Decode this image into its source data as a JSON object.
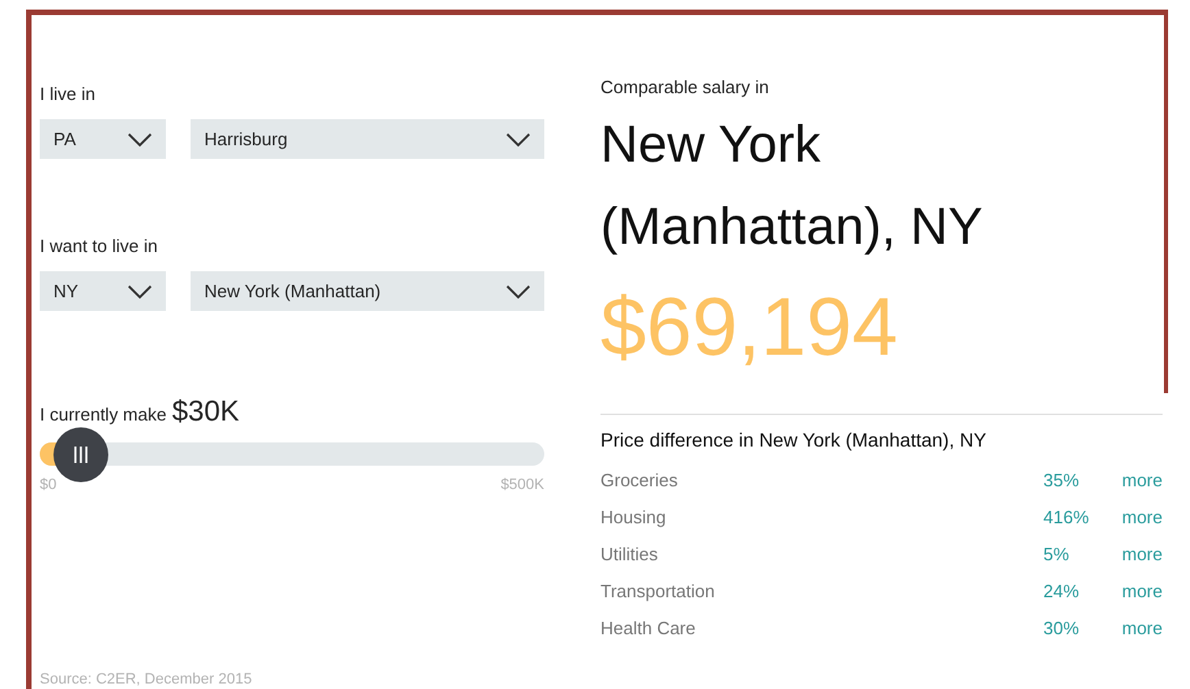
{
  "home": {
    "label": "I live in",
    "state": "PA",
    "city": "Harrisburg"
  },
  "destination": {
    "label": "I want to live in",
    "state": "NY",
    "city": "New York (Manhattan)"
  },
  "income": {
    "label": "I currently make",
    "amount": "$30K",
    "level": 0.06,
    "min_label": "$0",
    "max_label": "$500K"
  },
  "source": "Source: C2ER, December 2015",
  "result": {
    "label": "Comparable salary in",
    "city": "New York (Manhattan), NY",
    "salary": "$69,194"
  },
  "price_difference": {
    "title": "Price difference in New York (Manhattan), NY",
    "rows": [
      {
        "category": "Groceries",
        "percent": "35%",
        "link": "more"
      },
      {
        "category": "Housing",
        "percent": "416%",
        "link": "more"
      },
      {
        "category": "Utilities",
        "percent": "5%",
        "link": "more"
      },
      {
        "category": "Transportation",
        "percent": "24%",
        "link": "more"
      },
      {
        "category": "Health Care",
        "percent": "30%",
        "link": "more"
      }
    ]
  }
}
